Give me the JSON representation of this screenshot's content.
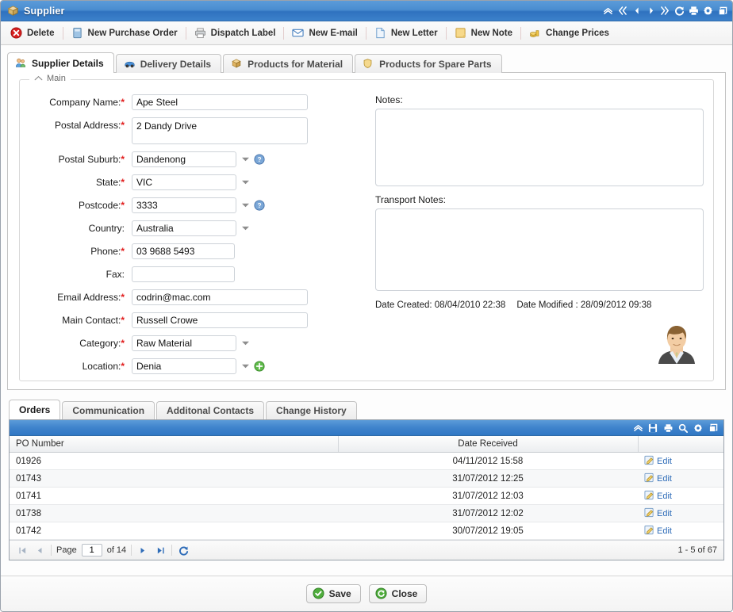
{
  "window": {
    "title": "Supplier",
    "title_icon": "supplier-box-icon",
    "tools": [
      {
        "name": "collapse-all-icon",
        "glyph": "»"
      },
      {
        "name": "first-record-icon",
        "glyph": "«"
      },
      {
        "name": "previous-record-icon",
        "glyph": "◄"
      },
      {
        "name": "next-record-icon",
        "glyph": "►"
      },
      {
        "name": "last-record-icon",
        "glyph": "»"
      },
      {
        "name": "refresh-icon",
        "glyph": "↻"
      },
      {
        "name": "print-icon",
        "glyph": "⎙"
      },
      {
        "name": "settings-gear-icon",
        "glyph": "⚙"
      },
      {
        "name": "restore-window-icon",
        "glyph": "❐"
      }
    ]
  },
  "toolbar": {
    "items": [
      {
        "label": "Delete",
        "icon": "delete-icon"
      },
      {
        "label": "New Purchase Order",
        "icon": "purchase-order-icon"
      },
      {
        "label": "Dispatch Label",
        "icon": "printer-icon"
      },
      {
        "label": "New E-mail",
        "icon": "email-icon"
      },
      {
        "label": "New Letter",
        "icon": "letter-icon"
      },
      {
        "label": "New Note",
        "icon": "note-icon"
      },
      {
        "label": "Change Prices",
        "icon": "coins-icon"
      }
    ]
  },
  "tabs": [
    {
      "label": "Supplier Details",
      "icon": "users-icon",
      "active": true
    },
    {
      "label": "Delivery Details",
      "icon": "truck-icon",
      "active": false
    },
    {
      "label": "Products for Material",
      "icon": "box-icon",
      "active": false
    },
    {
      "label": "Products for Spare Parts",
      "icon": "shield-icon",
      "active": false
    }
  ],
  "main": {
    "legend": "Main",
    "fields": [
      {
        "label": "Company Name:",
        "required": true,
        "value": "Ape Steel",
        "type": "text",
        "width": "wide"
      },
      {
        "label": "Postal Address:",
        "required": true,
        "value": "2 Dandy Drive",
        "type": "textarea",
        "width": "wide"
      },
      {
        "label": "Postal Suburb:",
        "required": true,
        "value": "Dandenong",
        "type": "combo",
        "width": "mid",
        "help": true
      },
      {
        "label": "State:",
        "required": true,
        "value": "VIC",
        "type": "combo",
        "width": "mid",
        "help": false
      },
      {
        "label": "Postcode:",
        "required": true,
        "value": "3333",
        "type": "combo",
        "width": "mid",
        "help": true
      },
      {
        "label": "Country:",
        "required": false,
        "value": "Australia",
        "type": "combo",
        "width": "mid",
        "help": false
      },
      {
        "label": "Phone:",
        "required": true,
        "value": "03 9688 5493",
        "type": "text",
        "width": "narrow"
      },
      {
        "label": "Fax:",
        "required": false,
        "value": "",
        "type": "text",
        "width": "narrow"
      },
      {
        "label": "Email Address:",
        "required": true,
        "value": "codrin@mac.com",
        "type": "text",
        "width": "wide"
      },
      {
        "label": "Main Contact:",
        "required": true,
        "value": "Russell Crowe",
        "type": "text",
        "width": "wide"
      },
      {
        "label": "Category:",
        "required": true,
        "value": "Raw Material",
        "type": "combo",
        "width": "mid",
        "help": false
      },
      {
        "label": "Location:",
        "required": true,
        "value": "Denia",
        "type": "combo",
        "width": "mid",
        "add": true
      }
    ],
    "notes": {
      "label": "Notes:",
      "value": ""
    },
    "transport_notes": {
      "label": "Transport Notes:",
      "value": ""
    },
    "date_created_label": "Date Created: 08/04/2010 22:38",
    "date_modified_label": "Date Modified : 28/09/2012 09:38",
    "avatar_name": "contact-avatar"
  },
  "grid_section": {
    "tabs": [
      {
        "label": "Orders",
        "active": true
      },
      {
        "label": "Communication",
        "active": false
      },
      {
        "label": "Additonal Contacts",
        "active": false
      },
      {
        "label": "Change History",
        "active": false
      }
    ],
    "header_tools": [
      {
        "name": "collapse-grid-icon",
        "glyph": "»"
      },
      {
        "name": "save-grid-icon",
        "glyph": "Ὃe"
      },
      {
        "name": "print-grid-icon",
        "glyph": "⎙"
      },
      {
        "name": "search-grid-icon",
        "glyph": "ὐd"
      },
      {
        "name": "settings-grid-icon",
        "glyph": "⚙"
      },
      {
        "name": "export-grid-icon",
        "glyph": "❐"
      }
    ],
    "columns": [
      "PO Number",
      "Date Received",
      ""
    ],
    "rows": [
      {
        "po": "01926",
        "date": "04/11/2012 15:58",
        "action": "Edit"
      },
      {
        "po": "01743",
        "date": "31/07/2012 12:25",
        "action": "Edit"
      },
      {
        "po": "01741",
        "date": "31/07/2012 12:03",
        "action": "Edit"
      },
      {
        "po": "01738",
        "date": "31/07/2012 12:02",
        "action": "Edit"
      },
      {
        "po": "01742",
        "date": "30/07/2012 19:05",
        "action": "Edit"
      }
    ],
    "pager": {
      "page_label": "Page",
      "page_value": "1",
      "of_label": "of 14",
      "range_label": "1 - 5 of 67"
    }
  },
  "footer": {
    "save_label": "Save",
    "close_label": "Close"
  },
  "colors": {
    "title_blue": "#3f83cc",
    "required_red": "#e11d1d",
    "link_blue": "#2e6cb8",
    "grid_header_blue": "#3077c4"
  }
}
